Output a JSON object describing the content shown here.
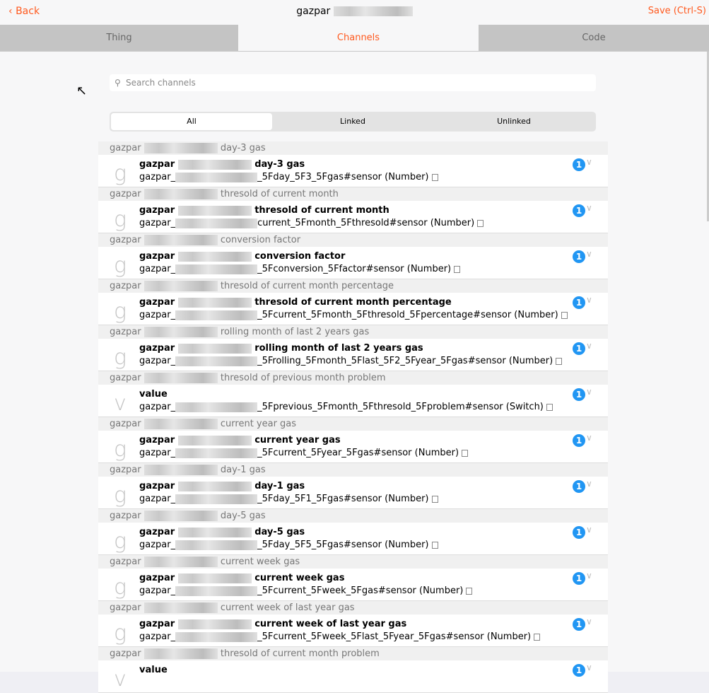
{
  "header": {
    "back_label": "Back",
    "title": "gazpar",
    "save_label": "Save (Ctrl-S)"
  },
  "tabs": [
    "Thing",
    "Channels",
    "Code"
  ],
  "search": {
    "placeholder": "Search channels"
  },
  "filters": [
    "All",
    "Linked",
    "Unlinked"
  ],
  "channels": [
    {
      "group": "day-3 gas",
      "letter": "g",
      "label": "day-3 gas",
      "prefix": "gazpar",
      "uid_suffix": "_5Fday_5F3_5Fgas#sensor (Number)",
      "links": "1"
    },
    {
      "group": "thresold of current month",
      "letter": "g",
      "label": "thresold of current month",
      "prefix": "gazpar",
      "uid_suffix": "current_5Fmonth_5Fthresold#sensor (Number)",
      "links": "1"
    },
    {
      "group": "conversion factor",
      "letter": "g",
      "label": "conversion factor",
      "prefix": "gazpar",
      "uid_suffix": "_5Fconversion_5Ffactor#sensor (Number)",
      "links": "1"
    },
    {
      "group": "thresold of current month percentage",
      "letter": "g",
      "label": "thresold of current month percentage",
      "prefix": "gazpar",
      "uid_suffix": "_5Fcurrent_5Fmonth_5Fthresold_5Fpercentage#sensor (Number)",
      "links": "1"
    },
    {
      "group": "rolling month of last 2 years gas",
      "letter": "g",
      "label": "rolling month of last 2 years gas",
      "prefix": "gazpar",
      "uid_suffix": "_5Frolling_5Fmonth_5Flast_5F2_5Fyear_5Fgas#sensor (Number)",
      "links": "1"
    },
    {
      "group": "thresold of previous month problem",
      "letter": "v",
      "label": "value",
      "prefix": "",
      "uid_suffix": "_5Fprevious_5Fmonth_5Fthresold_5Fproblem#sensor (Switch)",
      "links": "1"
    },
    {
      "group": "current year gas",
      "letter": "g",
      "label": "current year gas",
      "prefix": "gazpar",
      "uid_suffix": "_5Fcurrent_5Fyear_5Fgas#sensor (Number)",
      "links": "1"
    },
    {
      "group": "day-1 gas",
      "letter": "g",
      "label": "day-1 gas",
      "prefix": "gazpar",
      "uid_suffix": "_5Fday_5F1_5Fgas#sensor (Number)",
      "links": "1"
    },
    {
      "group": "day-5 gas",
      "letter": "g",
      "label": "day-5 gas",
      "prefix": "gazpar",
      "uid_suffix": "_5Fday_5F5_5Fgas#sensor (Number)",
      "links": "1"
    },
    {
      "group": "current week gas",
      "letter": "g",
      "label": "current week gas",
      "prefix": "gazpar",
      "uid_suffix": "_5Fcurrent_5Fweek_5Fgas#sensor (Number)",
      "links": "1"
    },
    {
      "group": "current week of last year gas",
      "letter": "g",
      "label": "current week of last year gas",
      "prefix": "gazpar",
      "uid_suffix": "_5Fcurrent_5Fweek_5Flast_5Fyear_5Fgas#sensor (Number)",
      "links": "1"
    },
    {
      "group": "thresold of current month problem",
      "letter": "v",
      "label": "value",
      "prefix": "",
      "uid_suffix": "",
      "links": "1"
    }
  ],
  "group_prefix": "gazpar",
  "uid_prefix": "gazpar_"
}
